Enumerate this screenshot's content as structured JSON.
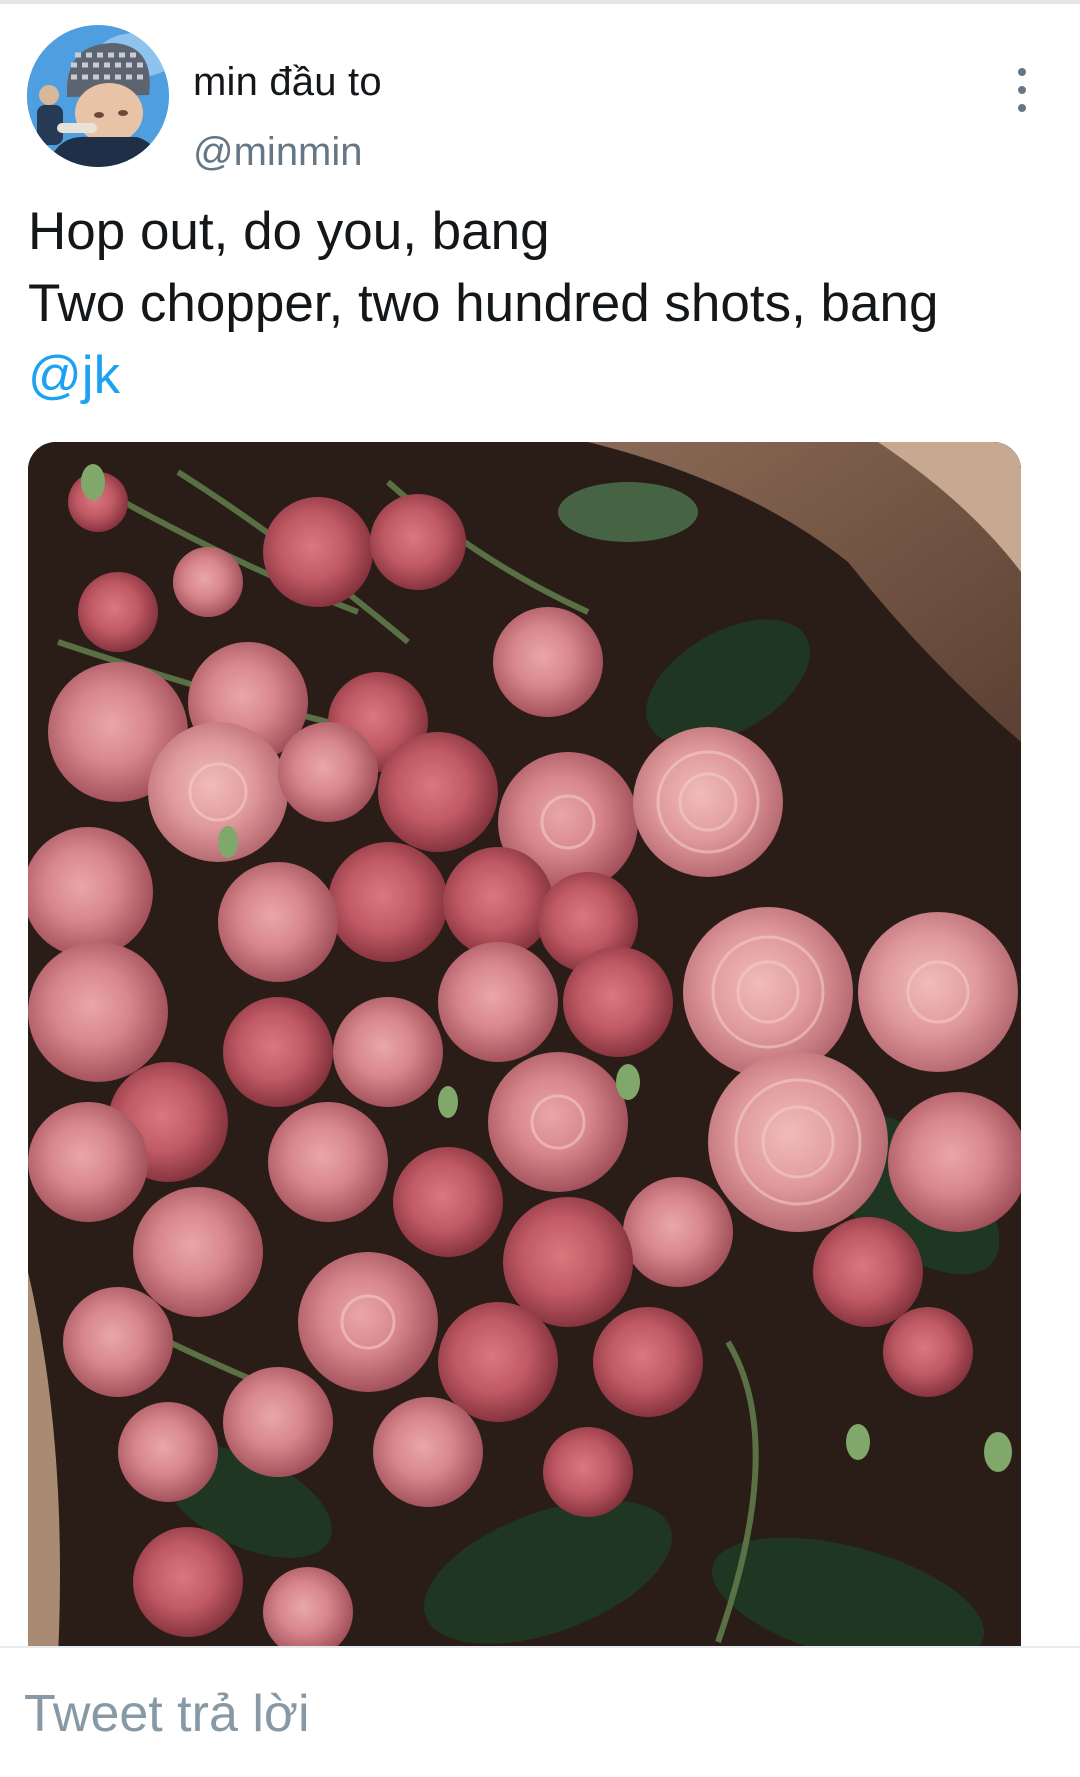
{
  "tweet": {
    "author": {
      "display_name": "min đầu to",
      "handle": "@minmin",
      "avatar_icon": "user-avatar"
    },
    "menu_icon": "more-vertical-icon",
    "lines": [
      "Hop out, do you, bang",
      "Two chopper, two hundred shots, bang"
    ],
    "mention": "@jk",
    "media_subject": "roses-bouquet-photo"
  },
  "reply": {
    "placeholder": "Tweet trả lời"
  },
  "colors": {
    "text": "#14171a",
    "secondary": "#657786",
    "link": "#1da1f2",
    "placeholder": "#8899a6"
  }
}
